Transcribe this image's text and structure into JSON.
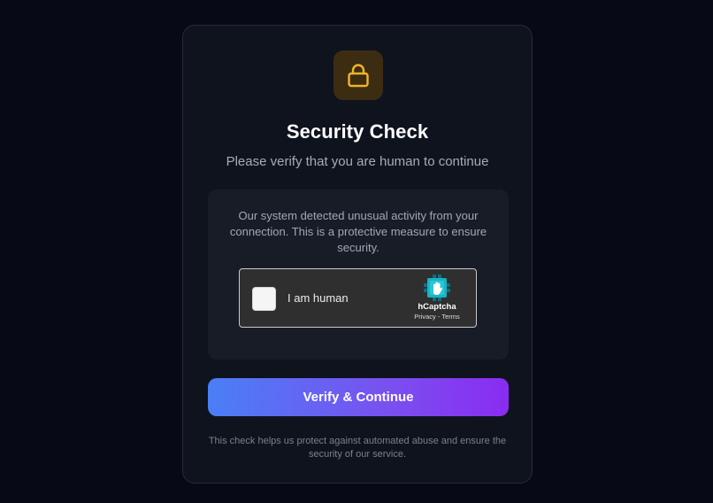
{
  "page": {
    "background_color": "#070a16",
    "card_color": "#0f131d"
  },
  "header": {
    "icon": "lock-icon",
    "icon_color": "#f0b429",
    "title": "Security Check",
    "subtitle": "Please verify that you are human to continue"
  },
  "notice": {
    "text": "Our system detected unusual activity from your connection. This is a protective measure to ensure security."
  },
  "captcha": {
    "checkbox_checked": false,
    "label": "I am human",
    "brand": "hCaptcha",
    "brand_icon": "hcaptcha-logo-icon",
    "privacy_link": "Privacy",
    "separator": " - ",
    "terms_link": "Terms"
  },
  "actions": {
    "verify_label": "Verify & Continue",
    "gradient_start": "#4a7ff6",
    "gradient_end": "#8a2cf1"
  },
  "footer": {
    "text": "This check helps us protect against automated abuse and ensure the security of our service."
  }
}
